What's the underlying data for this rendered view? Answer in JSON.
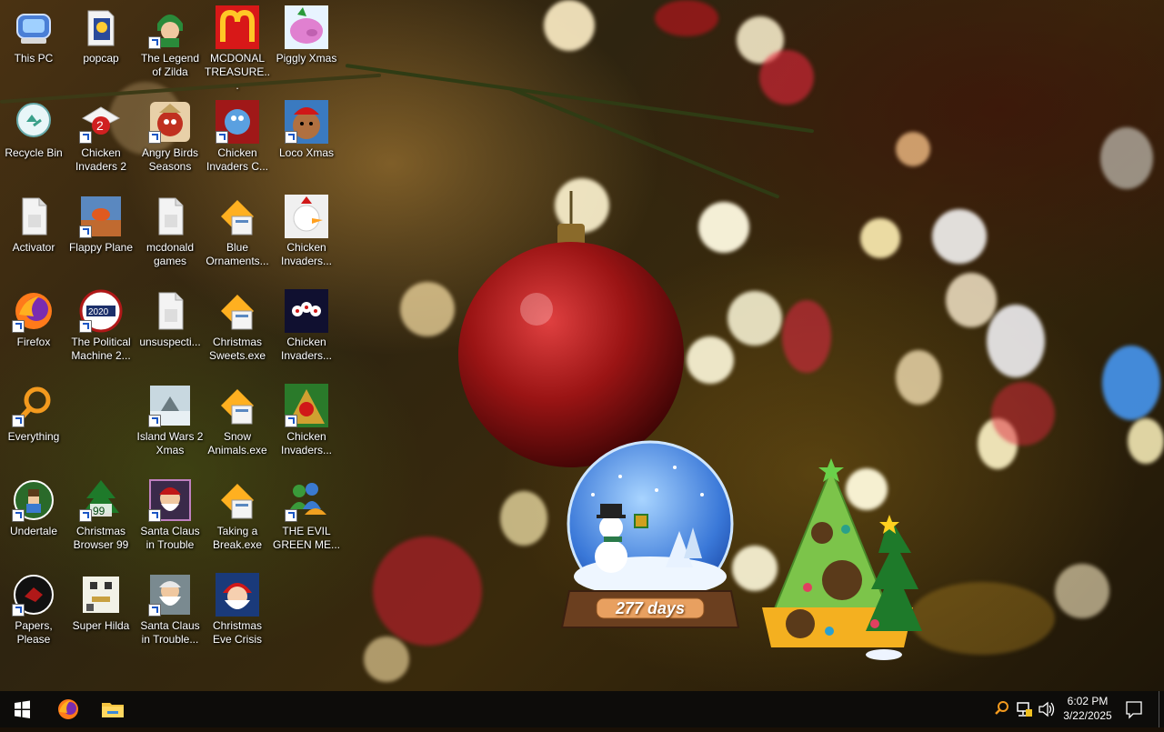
{
  "desktop": {
    "icons": [
      {
        "label": "This PC",
        "icon": "this-pc-icon",
        "shortcut": false
      },
      {
        "label": "Recycle Bin",
        "icon": "recycle-bin-icon",
        "shortcut": false
      },
      {
        "label": "Activator",
        "icon": "file-icon",
        "shortcut": false
      },
      {
        "label": "Firefox",
        "icon": "firefox-icon",
        "shortcut": true
      },
      {
        "label": "Everything",
        "icon": "search-magnifier-icon",
        "shortcut": true
      },
      {
        "label": "Undertale",
        "icon": "undertale-icon",
        "shortcut": true
      },
      {
        "label": "Papers, Please",
        "icon": "papers-please-icon",
        "shortcut": true
      },
      {
        "label": "popcap",
        "icon": "popcap-icon",
        "shortcut": false
      },
      {
        "label": "Chicken Invaders 2",
        "icon": "chicken-invaders-2-icon",
        "shortcut": true
      },
      {
        "label": "Flappy Plane",
        "icon": "flappy-plane-icon",
        "shortcut": true
      },
      {
        "label": "The Political Machine 2...",
        "icon": "political-machine-icon",
        "shortcut": true
      },
      {
        "label": "Christmas Browser 99",
        "icon": "christmas-tree-icon",
        "shortcut": true
      },
      {
        "label": "Super Hilda",
        "icon": "super-hilda-icon",
        "shortcut": false
      },
      {
        "label": "The Legend of Zilda",
        "icon": "zelda-icon",
        "shortcut": true
      },
      {
        "label": "Angry Birds Seasons",
        "icon": "angry-birds-icon",
        "shortcut": true
      },
      {
        "label": "mcdonald games",
        "icon": "file-icon",
        "shortcut": false
      },
      {
        "label": "unsuspecti...",
        "icon": "file-icon",
        "shortcut": false
      },
      {
        "label": "Island Wars 2 Xmas",
        "icon": "island-wars-icon",
        "shortcut": true
      },
      {
        "label": "Santa Claus in Trouble",
        "icon": "santa-claus-icon",
        "shortcut": true
      },
      {
        "label": "Santa Claus in Trouble...",
        "icon": "santa-claus-icon",
        "shortcut": true
      },
      {
        "label": "MCDONAL TREASURE...",
        "icon": "mcdonalds-icon",
        "shortcut": false
      },
      {
        "label": "Chicken Invaders C...",
        "icon": "chicken-invaders-icon",
        "shortcut": true
      },
      {
        "label": "Blue Ornaments...",
        "icon": "installer-icon",
        "shortcut": false
      },
      {
        "label": "Christmas Sweets.exe",
        "icon": "installer-icon",
        "shortcut": false
      },
      {
        "label": "Snow Animals.exe",
        "icon": "installer-icon",
        "shortcut": false
      },
      {
        "label": "Taking a Break.exe",
        "icon": "installer-icon",
        "shortcut": false
      },
      {
        "label": "Christmas Eve Crisis",
        "icon": "santa-face-icon",
        "shortcut": false
      },
      {
        "label": "Piggly Xmas",
        "icon": "piggly-icon",
        "shortcut": false
      },
      {
        "label": "Loco Xmas",
        "icon": "teddy-bear-icon",
        "shortcut": true
      },
      {
        "label": "Chicken Invaders...",
        "icon": "chicken-invaders-icon",
        "shortcut": false
      },
      {
        "label": "Chicken Invaders...",
        "icon": "chicken-invaders-icon",
        "shortcut": false
      },
      {
        "label": "Chicken Invaders...",
        "icon": "chicken-invaders-icon",
        "shortcut": true
      },
      {
        "label": "THE EVIL GREEN ME...",
        "icon": "messenger-icon",
        "shortcut": true
      }
    ]
  },
  "widget": {
    "snowglobe_label": "277 days"
  },
  "taskbar": {
    "start": "windows-start-icon",
    "pinned": [
      {
        "name": "firefox-taskbar-icon"
      },
      {
        "name": "file-explorer-taskbar-icon"
      }
    ],
    "tray": {
      "time": "6:02 PM",
      "date": "3/22/2025"
    }
  },
  "colors": {
    "taskbar_bg": "#0d0c0a",
    "snowglobe_base": "#6b3f1f",
    "tree_widget": "#7cc44a"
  }
}
